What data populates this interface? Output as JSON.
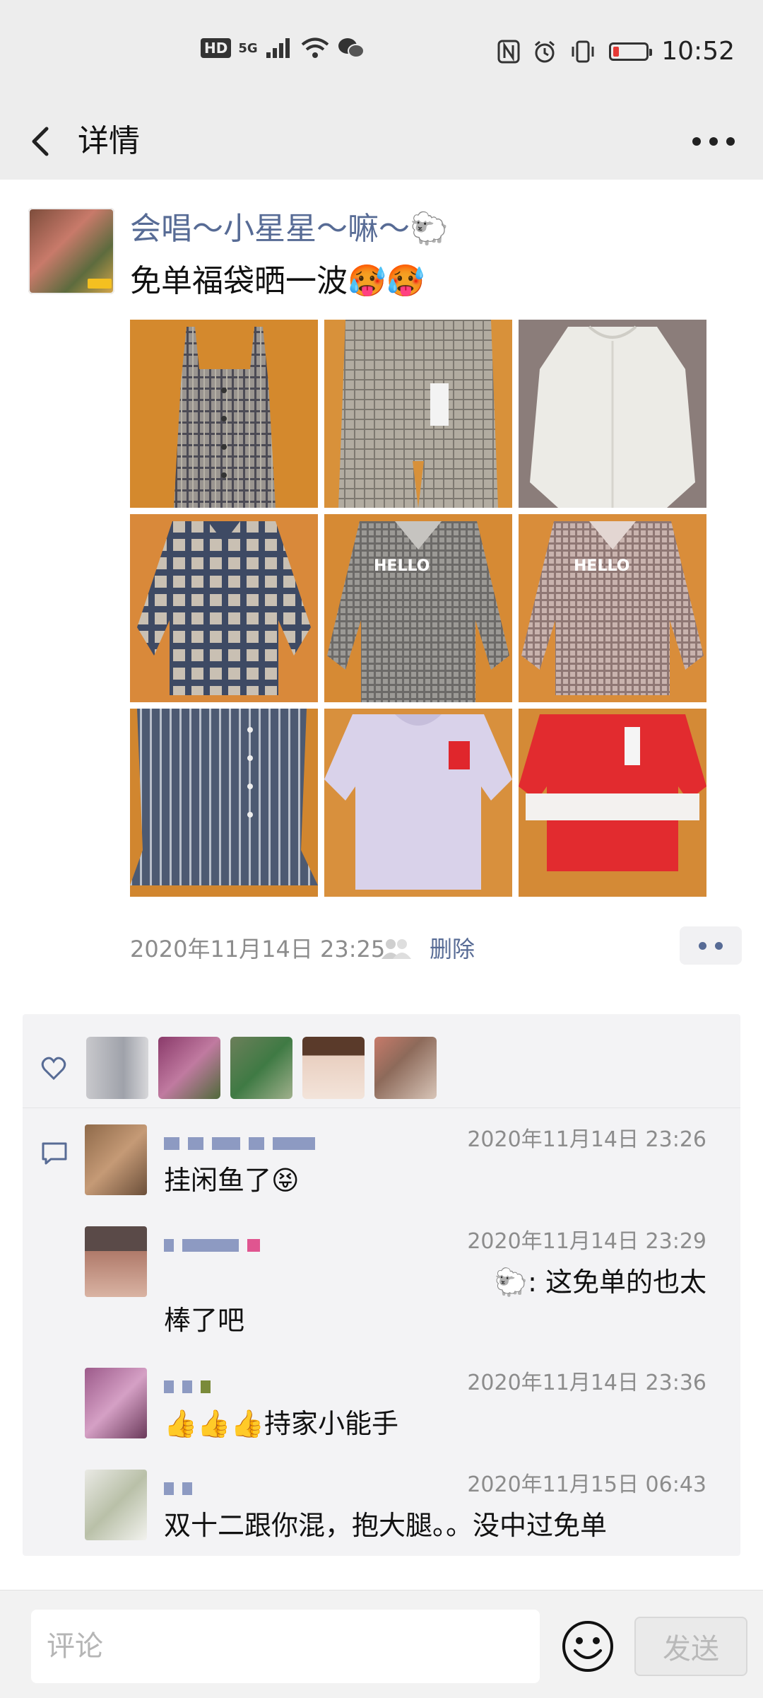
{
  "status_bar": {
    "hd": "HD",
    "network": "5G",
    "time": "10:52",
    "battery_level": 0.18
  },
  "nav": {
    "title": "详情"
  },
  "post": {
    "author": "会唱～小星星～嘛～🐑",
    "text": "免单福袋晒一波",
    "text_emojis": [
      "🥵",
      "🥵"
    ],
    "photos": [
      "plaid-dress-icon",
      "plaid-skirt-icon",
      "white-coat-icon",
      "plaid-shirt-icon",
      "hello-shirt-gray-icon",
      "hello-shirt-pink-icon",
      "striped-skirt-icon",
      "lavender-tshirt-icon",
      "red-tshirt-icon"
    ],
    "timestamp": "2020年11月14日 23:25",
    "delete_label": "删除"
  },
  "likes": {
    "count": 5
  },
  "comments": [
    {
      "time": "2020年11月14日 23:26",
      "text": "挂闲鱼了",
      "emoji": "😝"
    },
    {
      "time": "2020年11月14日 23:29",
      "text": "🐑: 这免单的也太",
      "text2": "棒了吧"
    },
    {
      "time": "2020年11月14日 23:36",
      "text": "持家小能手",
      "emojis": [
        "👍",
        "👍",
        "👍"
      ]
    },
    {
      "time": "2020年11月15日 06:43",
      "text": "双十二跟你混，抱大腿。。没中过免单"
    }
  ],
  "input_bar": {
    "placeholder": "评论",
    "send_label": "发送"
  },
  "colors": {
    "link": "#576b95",
    "background": "#ededed",
    "comment_bg": "#f3f3f5"
  }
}
